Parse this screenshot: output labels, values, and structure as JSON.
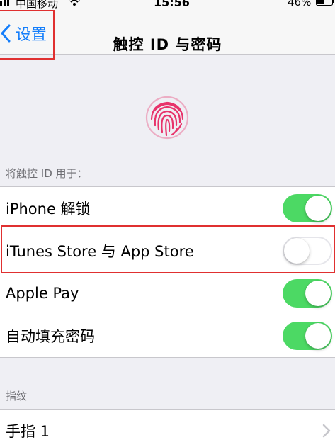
{
  "status_bar": {
    "carrier": "中国移动",
    "time": "15:56",
    "battery_percent": "46%",
    "icons": [
      "signal-icon",
      "wifi-icon",
      "battery-icon"
    ]
  },
  "nav": {
    "back_label": "设置",
    "title": "触控 ID 与密码"
  },
  "fingerprint": {
    "icon": "fingerprint-icon",
    "color": "#e8336b"
  },
  "use_section": {
    "header": "将触控 ID 用于：",
    "items": [
      {
        "label": "iPhone 解锁",
        "enabled": true
      },
      {
        "label": "iTunes Store 与 App Store",
        "enabled": false
      },
      {
        "label": "Apple Pay",
        "enabled": true
      },
      {
        "label": "自动填充密码",
        "enabled": true
      }
    ]
  },
  "fingerprints_section": {
    "header": "指纹",
    "items": [
      {
        "label": "手指 1"
      }
    ]
  },
  "colors": {
    "accent": "#147efb",
    "toggle_on": "#4cd964",
    "highlight": "#e03030"
  }
}
